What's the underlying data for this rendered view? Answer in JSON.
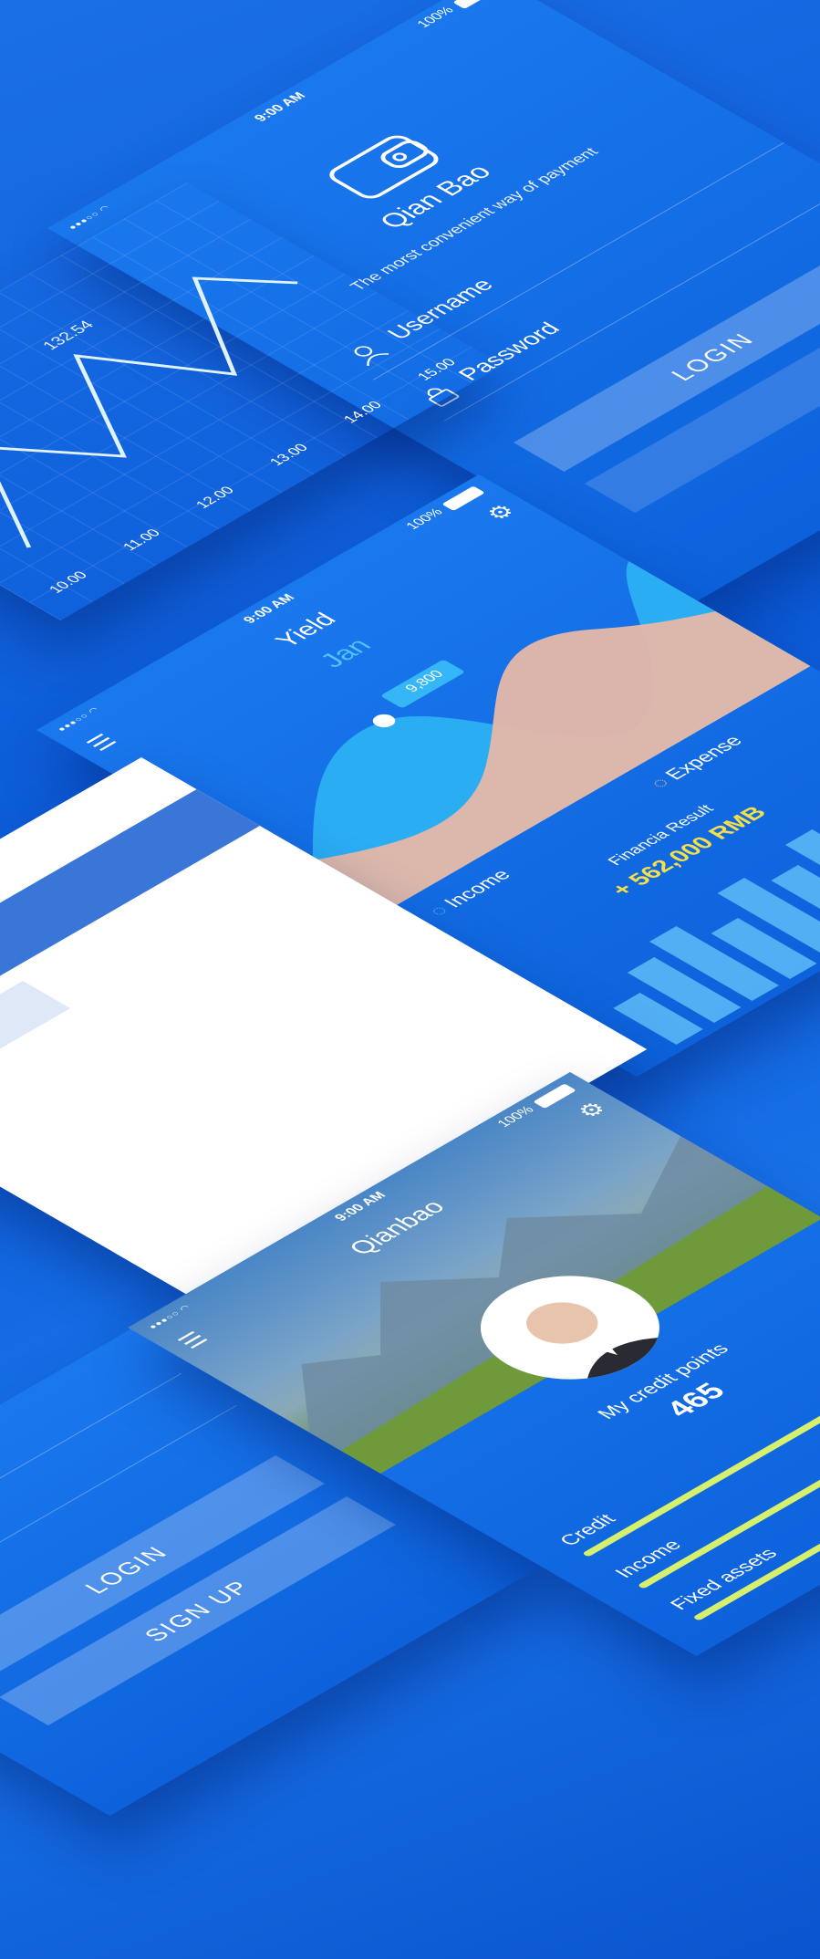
{
  "status": {
    "time": "9:00 AM",
    "battery": "100%"
  },
  "login": {
    "app_name": "Qian Bao",
    "tagline": "The morst convenient way of payment",
    "username_placeholder": "Username",
    "password_placeholder": "Password",
    "login_button": "LOGIN"
  },
  "chart_panel": {
    "peak_value": "132.54",
    "x_ticks": [
      "10.00",
      "11.00",
      "12.00",
      "13.00",
      "14.00",
      "15.00"
    ]
  },
  "yield_screen": {
    "title": "Yield",
    "month": "Jan",
    "tooltip_value": "9,800",
    "income_label": "Income",
    "expense_label": "Expense",
    "result_label": "Financia Result",
    "result_value": "+ 562,000 RMB"
  },
  "signup_screen": {
    "login_button": "LOGIN",
    "signup_button": "SIGN UP"
  },
  "profile_screen": {
    "title": "Qianbao",
    "credit_label": "My credit points",
    "credit_value": "465",
    "bars": [
      {
        "label": "Credit",
        "level": 0.85
      },
      {
        "label": "Income",
        "level": 0.7
      },
      {
        "label": "Fixed assets",
        "level": 0.5
      }
    ]
  },
  "colors": {
    "accent": "#1a78ee",
    "highlight": "#f5e04a",
    "bar": "#d6f06e",
    "area_back": "#2eb4f5",
    "area_front": "#e6b8a8"
  }
}
